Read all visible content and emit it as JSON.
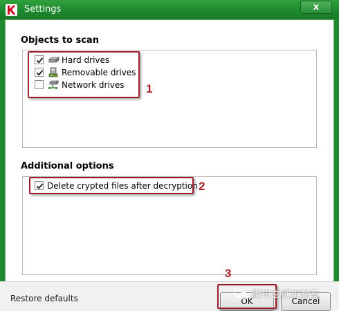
{
  "window": {
    "title": "Settings",
    "close_glyph": "x",
    "icon": "kaspersky-logo-icon"
  },
  "objects_section": {
    "title": "Objects to scan",
    "items": [
      {
        "label": "Hard drives",
        "checked": true,
        "icon": "hard-drive-icon"
      },
      {
        "label": "Removable drives",
        "checked": true,
        "icon": "removable-drive-icon"
      },
      {
        "label": "Network drives",
        "checked": false,
        "icon": "network-drive-icon"
      }
    ]
  },
  "additional_section": {
    "title": "Additional options",
    "items": [
      {
        "label": "Delete crypted files after decryption",
        "checked": true
      }
    ]
  },
  "annotations": [
    "1",
    "2",
    "3"
  ],
  "footer": {
    "restore_label": "Restore defaults",
    "ok_label": "OK",
    "cancel_label": "Cancel"
  },
  "watermark": {
    "text": "腾讯玄武实验室"
  },
  "colors": {
    "titlebar": "#1f8a2f",
    "annotation": "#9d1f2a",
    "footer_bg": "#f0f0f0"
  }
}
